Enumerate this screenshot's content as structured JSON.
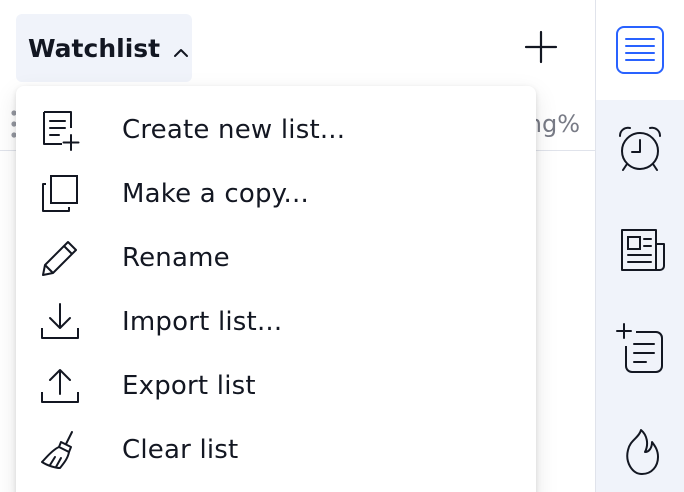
{
  "header": {
    "watchlist_label": "Watchlist",
    "column_header": "ng%"
  },
  "menu": {
    "items": [
      {
        "label": "Create new list...",
        "icon": "list-add-icon"
      },
      {
        "label": "Make a copy...",
        "icon": "copy-icon"
      },
      {
        "label": "Rename",
        "icon": "pencil-icon"
      },
      {
        "label": "Import list...",
        "icon": "download-icon"
      },
      {
        "label": "Export list",
        "icon": "upload-icon"
      },
      {
        "label": "Clear list",
        "icon": "broom-icon"
      }
    ]
  },
  "toolbar": {
    "items": [
      {
        "icon": "watchlist-icon",
        "active": true
      },
      {
        "icon": "alarm-clock-icon",
        "active": false
      },
      {
        "icon": "news-icon",
        "active": false
      },
      {
        "icon": "ideas-icon",
        "active": false
      },
      {
        "icon": "hotlist-flame-icon",
        "active": false
      }
    ]
  },
  "colors": {
    "accent": "#2962ff",
    "text": "#131722",
    "muted": "#787b86",
    "toolbar_bg": "#f0f3fa"
  }
}
